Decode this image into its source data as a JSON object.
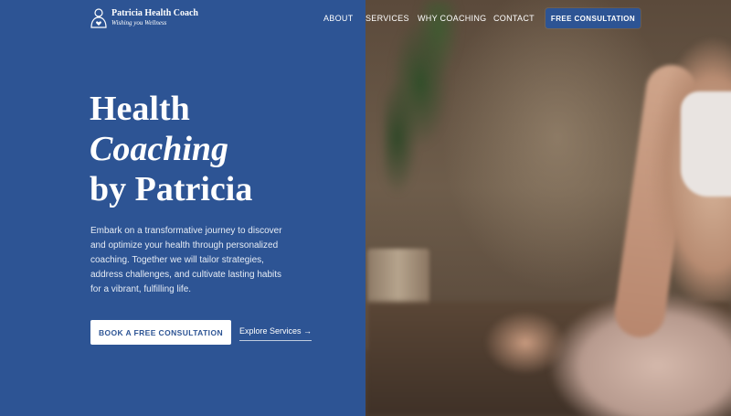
{
  "brand": {
    "title": "Patricia Health Coach",
    "tagline": "Wishing you Wellness"
  },
  "nav": {
    "items": [
      {
        "label": "ABOUT"
      },
      {
        "label": "SERVICES"
      },
      {
        "label": "WHY COACHING"
      },
      {
        "label": "CONTACT"
      }
    ],
    "cta_label": "FREE CONSULTATION"
  },
  "hero": {
    "title_line1": "Health",
    "title_line2": "Coaching",
    "title_line3": "by Patricia",
    "description": "Embark on a transformative journey to discover and optimize your health through personalized coaching. Together we will tailor strategies, address challenges, and cultivate lasting habits for a vibrant, fulfilling life.",
    "primary_button": "BOOK A FREE CONSULTATION",
    "secondary_link": "Explore Services →"
  },
  "colors": {
    "primary": "#2d5494",
    "text_light": "#ffffff"
  },
  "icons": {
    "logo": "person-heart-icon"
  },
  "image": {
    "subject": "blurred photo of a woman meditating beside a plant"
  }
}
